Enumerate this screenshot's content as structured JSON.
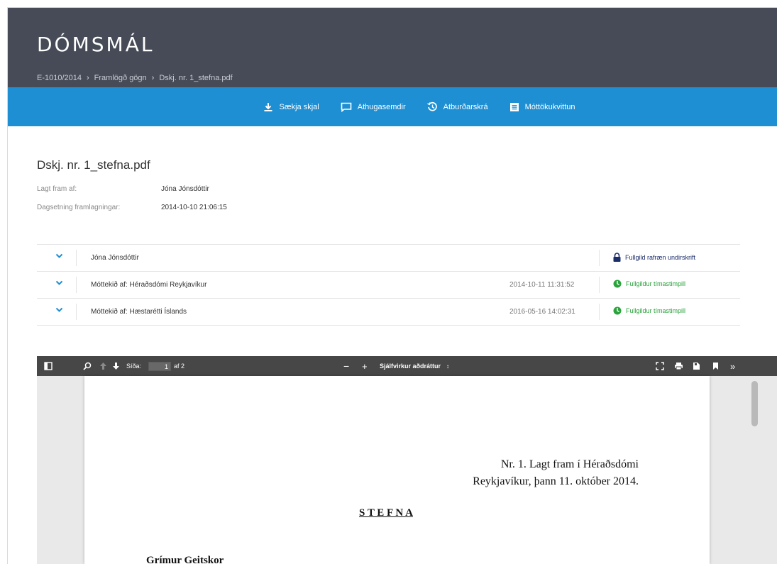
{
  "header": {
    "title": "DÓMSMÁL",
    "breadcrumb": [
      "E-1010/2014",
      "Framlögð gögn",
      "Dskj. nr. 1_stefna.pdf"
    ]
  },
  "actions": {
    "download": "Sækja skjal",
    "comments": "Athugasemdir",
    "history": "Atburðarskrá",
    "receipt": "Móttökukvittun"
  },
  "document": {
    "title": "Dskj. nr. 1_stefna.pdf",
    "submitted_by_label": "Lagt fram af:",
    "submitted_by": "Jóna Jónsdóttir",
    "date_label": "Dagsetning framlagningar:",
    "date": "2014-10-10 21:06:15"
  },
  "signatures": [
    {
      "name": "Jóna Jónsdóttir",
      "date": "",
      "status": "Fullgild rafræn undirskrift",
      "status_icon": "lock-icon",
      "status_color": "#1b2c6b"
    },
    {
      "name": "Móttekið af: Héraðsdómi Reykjavíkur",
      "date": "2014-10-11 11:31:52",
      "status": "Fullgildur tímastimpill",
      "status_icon": "timestamp-icon",
      "status_color": "#2aa33c"
    },
    {
      "name": "Móttekið af: Hæstarétti Íslands",
      "date": "2016-05-16 14:02:31",
      "status": "Fullgildur tímastimpill",
      "status_icon": "timestamp-icon",
      "status_color": "#2aa33c"
    }
  ],
  "viewer": {
    "page_label": "Síða:",
    "page_value": "1",
    "page_total": "af 2",
    "zoom": "Sjálfvirkur aðdráttur",
    "pdf": {
      "line1": "Nr.  1. Lagt fram í Héraðsdómi",
      "line2": "Reykjavíkur, þann 11. október 2014.",
      "heading": "S T E F N A",
      "party": "Grímur Geitskor"
    }
  },
  "colors": {
    "header_bg": "#464b57",
    "action_bar": "#1e8fd3",
    "chevron": "#1e8fd3",
    "valid_green": "#2aa33c",
    "lock_navy": "#1b2c6b"
  }
}
